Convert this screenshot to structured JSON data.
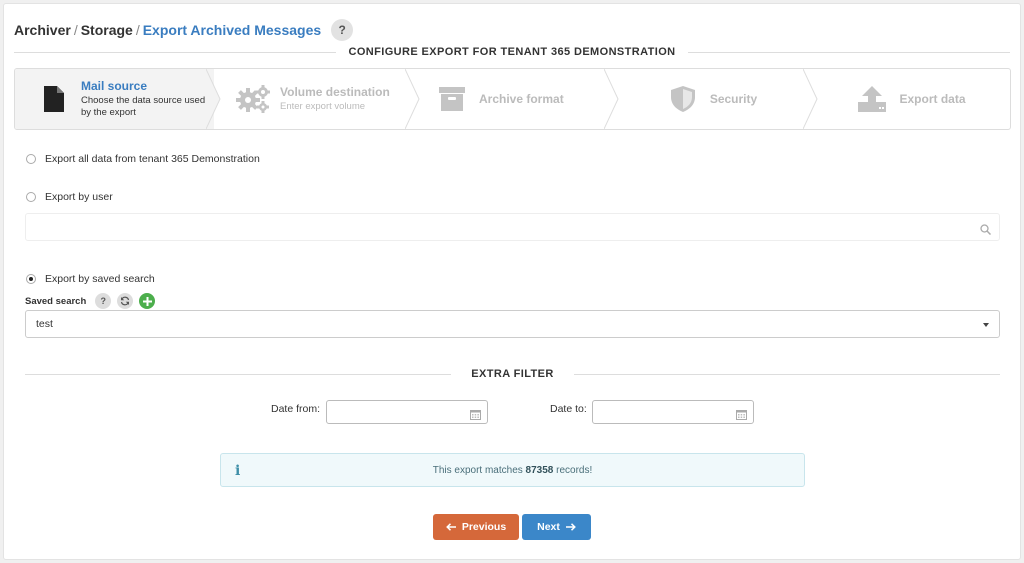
{
  "breadcrumb": {
    "items": [
      "Archiver",
      "Storage"
    ],
    "separator": "/",
    "current": "Export Archived Messages",
    "help_label": "?"
  },
  "configure_title": "CONFIGURE EXPORT FOR TENANT 365 DEMONSTRATION",
  "wizard": {
    "steps": [
      {
        "title": "Mail source",
        "subtitle": "Choose the data source used by the export",
        "icon": "file-icon",
        "active": true
      },
      {
        "title": "Volume destination",
        "subtitle": "Enter export volume",
        "icon": "gears-icon",
        "active": false
      },
      {
        "title": "Archive format",
        "subtitle": "",
        "icon": "archive-box-icon",
        "active": false
      },
      {
        "title": "Security",
        "subtitle": "",
        "icon": "shield-icon",
        "active": false
      },
      {
        "title": "Export data",
        "subtitle": "",
        "icon": "upload-icon",
        "active": false
      }
    ]
  },
  "options": {
    "all_data": "Export all data from tenant 365 Demonstration",
    "by_user": "Export by user",
    "by_saved_search": "Export by saved search",
    "selected": "by_saved_search"
  },
  "user_search": {
    "value": "",
    "placeholder": ""
  },
  "saved_search": {
    "label": "Saved search",
    "help": "?",
    "selected_value": "test"
  },
  "extra_filter": {
    "title": "EXTRA FILTER",
    "date_from_label": "Date from:",
    "date_to_label": "Date to:",
    "date_from_value": "",
    "date_to_value": ""
  },
  "info": {
    "prefix": "This export matches",
    "count": "87358",
    "suffix": "records!",
    "icon": "i"
  },
  "buttons": {
    "previous": "Previous",
    "next": "Next"
  },
  "colors": {
    "accent": "#3a7dc0",
    "previous": "#d5683a",
    "next": "#3b87c9",
    "add": "#4cae4c",
    "info_bg": "#f0f9fb"
  }
}
